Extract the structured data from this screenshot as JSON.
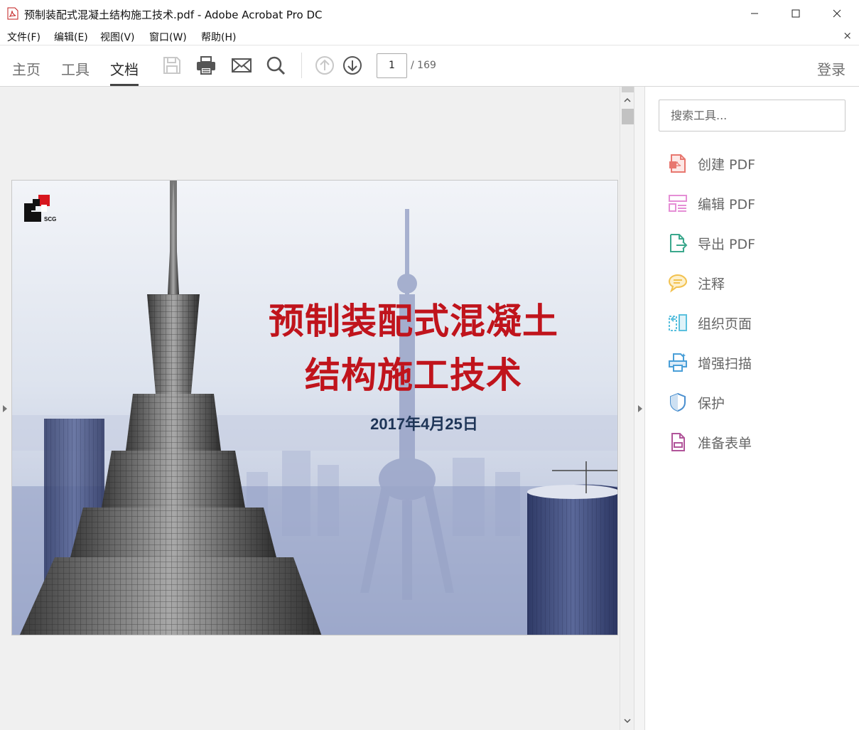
{
  "window": {
    "title": "预制装配式混凝土结构施工技术.pdf - Adobe Acrobat Pro DC"
  },
  "menu": {
    "items": [
      "文件(F)",
      "编辑(E)",
      "视图(V)",
      "窗口(W)",
      "帮助(H)"
    ],
    "close_glyph": "×"
  },
  "toolbar": {
    "tabs": [
      "主页",
      "工具",
      "文档"
    ],
    "active_tab": "文档",
    "page_current": "1",
    "page_total": "/ 169",
    "login_label": "登录"
  },
  "document": {
    "title_line1": "预制装配式混凝土",
    "title_line2": "结构施工技术",
    "date": "2017年4月25日",
    "logo_text": "SCG",
    "title_color": "#c0141c",
    "date_color": "#1e3557"
  },
  "right_pane": {
    "search_placeholder": "搜索工具...",
    "tools": [
      {
        "label": "创建 PDF",
        "icon": "create-pdf-icon",
        "color": "#e8776f"
      },
      {
        "label": "编辑 PDF",
        "icon": "edit-pdf-icon",
        "color": "#e58fd6"
      },
      {
        "label": "导出 PDF",
        "icon": "export-pdf-icon",
        "color": "#3ba88d"
      },
      {
        "label": "注释",
        "icon": "comment-icon",
        "color": "#f2c14e"
      },
      {
        "label": "组织页面",
        "icon": "organize-pages-icon",
        "color": "#5bc0de"
      },
      {
        "label": "增强扫描",
        "icon": "enhance-scan-icon",
        "color": "#4a9fd8"
      },
      {
        "label": "保护",
        "icon": "protect-icon",
        "color": "#4a8fcf"
      },
      {
        "label": "准备表单",
        "icon": "prepare-form-icon",
        "color": "#b1559a"
      }
    ]
  }
}
